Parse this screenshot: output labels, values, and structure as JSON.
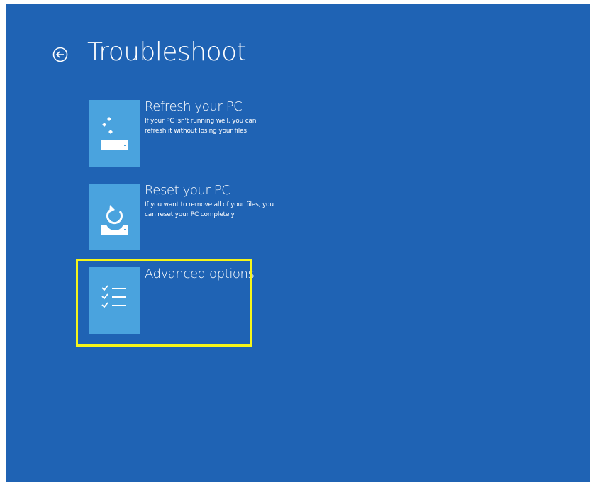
{
  "page": {
    "title": "Troubleshoot",
    "background_color": "#1f63b4",
    "tile_color": "#4aa3de",
    "highlight_color": "#f5f51a"
  },
  "icons": {
    "back": "back-arrow-circle-icon",
    "refresh": "refresh-drive-sparkle-icon",
    "reset": "reset-drive-circular-arrow-icon",
    "advanced": "checklist-icon"
  },
  "options": [
    {
      "name": "Refresh your PC",
      "description": "If your PC isn't running well, you can refresh it without losing your files"
    },
    {
      "name": "Reset your PC",
      "description": "If you want to remove all of your files, you can reset your PC completely"
    },
    {
      "name": "Advanced options",
      "description": ""
    }
  ],
  "highlighted_option": "Advanced options"
}
